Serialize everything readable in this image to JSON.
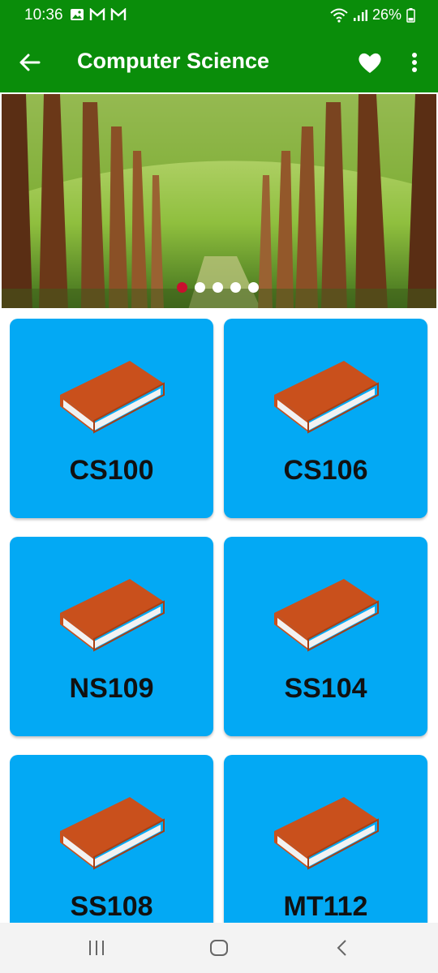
{
  "status_bar": {
    "time": "10:36",
    "battery": "26%",
    "icons": [
      "gallery-icon",
      "gmail-icon",
      "gmail-icon",
      "wifi-icon",
      "signal-icon",
      "battery-icon"
    ]
  },
  "app_bar": {
    "title": "Computer Science",
    "icons": [
      "back-arrow-icon",
      "heart-icon",
      "more-vert-icon"
    ]
  },
  "banner": {
    "image": "forest-path-photo",
    "slides": 5,
    "active_slide": 1
  },
  "courses": [
    {
      "code": "CS100",
      "icon": "book-icon"
    },
    {
      "code": "CS106",
      "icon": "book-icon"
    },
    {
      "code": "NS109",
      "icon": "book-icon"
    },
    {
      "code": "SS104",
      "icon": "book-icon"
    },
    {
      "code": "SS108",
      "icon": "book-icon"
    },
    {
      "code": "MT112",
      "icon": "book-icon"
    }
  ],
  "nav_bar": {
    "icons": [
      "recent-apps-icon",
      "home-icon",
      "back-icon"
    ]
  },
  "colors": {
    "app_bar": "#0a8d0a",
    "card": "#03a9f4",
    "active_dot": "#c8102e",
    "book": "#c9501c"
  }
}
